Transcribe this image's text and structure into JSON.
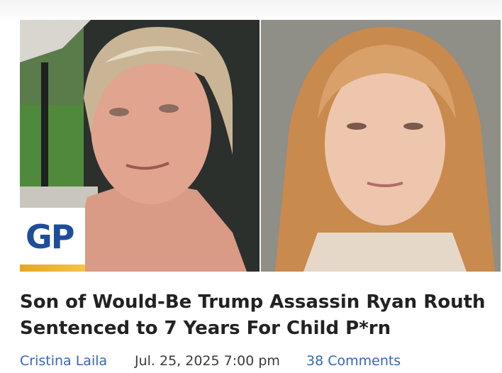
{
  "logo": {
    "text": "GP"
  },
  "article": {
    "headline": "Son of Would-Be Trump Assassin Ryan Routh Sentenced to 7 Years For Child P*rn",
    "author": "Cristina Laila",
    "date": "Jul. 25, 2025 7:00 pm",
    "comments": "38 Comments"
  },
  "colors": {
    "headline": "#222222",
    "link": "#3567b3",
    "logo_blue": "#1e4d9a",
    "logo_gold": "#e8a526"
  }
}
